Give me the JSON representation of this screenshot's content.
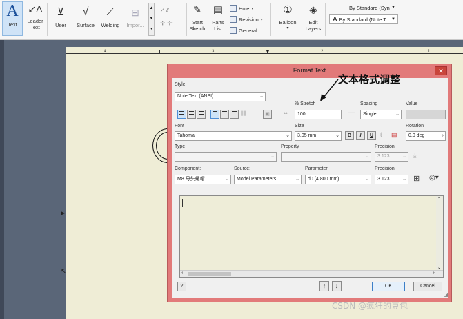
{
  "ribbon": {
    "text_label": "Text",
    "leader_text_label": "Leader\nText",
    "user_label": "User",
    "surface_label": "Surface",
    "welding_label": "Welding",
    "import_label": "Impor...",
    "start_sketch_label": "Start\nSketch",
    "parts_list_label": "Parts\nList",
    "hole_label": "Hole",
    "revision_label": "Revision",
    "general_label": "General",
    "balloon_label": "Balloon",
    "edit_layers_label": "Edit\nLayers",
    "style_top": "By Standard (Syn",
    "style_bottom": "By Standard (Note T"
  },
  "ruler": {
    "nums": [
      "4",
      "3",
      "2",
      "1"
    ]
  },
  "dialog": {
    "title": "Format Text",
    "close": "✕",
    "style_label": "Style:",
    "style_value": "Note Text (ANSI)",
    "stretch_label": "% Stretch",
    "stretch_value": "100",
    "spacing_label": "Spacing",
    "spacing_value": "Single",
    "value_label": "Value",
    "font_label": "Font",
    "font_value": "Tahoma",
    "size_label": "Size",
    "size_value": "3.05 mm",
    "bold": "B",
    "italic": "I",
    "underline": "U",
    "rotation_label": "Rotation",
    "rotation_value": "0.0 deg",
    "type_label": "Type",
    "property_label": "Property",
    "precision_label": "Precision",
    "precision_value": "3.123",
    "component_label": "Component:",
    "component_value": "M8 母头螺帽",
    "source_label": "Source:",
    "source_value": "Model Parameters",
    "parameter_label": "Parameter:",
    "parameter_value": "d0 (4.800 mm)",
    "precision2_label": "Precision",
    "precision2_value": "3.123",
    "help": "?",
    "ok": "OK",
    "cancel": "Cancel"
  },
  "annotation": "文本格式调整",
  "watermark": "CSDN @疯狂的豆包",
  "colors": {
    "dialog_frame": "#e27a7a",
    "sheet": "#efedd6",
    "background_dark": "#5a6678"
  }
}
